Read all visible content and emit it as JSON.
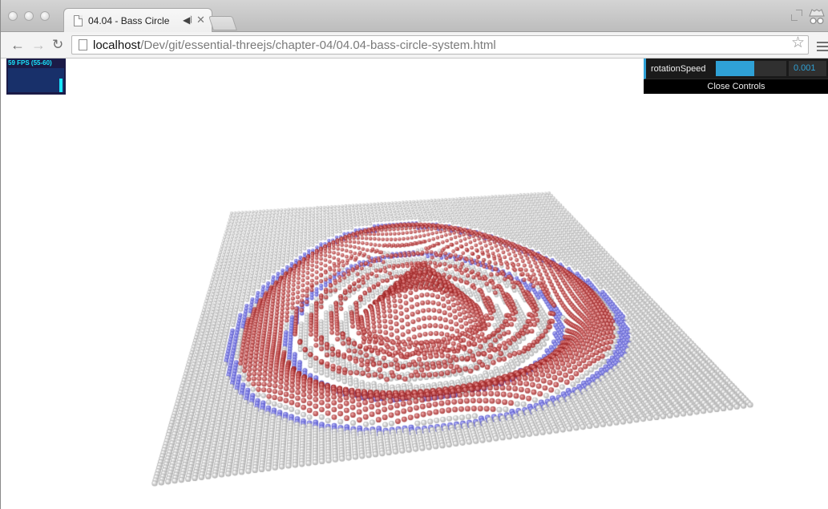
{
  "browser": {
    "tab": {
      "title": "04.04 - Bass Circle",
      "audio_icon": "speaker-icon",
      "close_icon": "close-icon"
    },
    "address": {
      "host": "localhost",
      "path": "/Dev/git/essential-threejs/chapter-04/04.04-bass-circle-system.html"
    },
    "icons": [
      "back-icon",
      "forward-icon",
      "reload-icon",
      "page-icon",
      "bookmark-star-icon",
      "menu-icon",
      "incognito-icon",
      "fullscreen-icon"
    ]
  },
  "stats": {
    "text": "59 FPS (55-60)",
    "level_fraction": 0.58,
    "color": "#19e6ff"
  },
  "gui": {
    "controls": [
      {
        "label": "rotationSpeed",
        "value": "0.001",
        "fill_fraction": 0.55
      }
    ],
    "close_label": "Close Controls",
    "accent": "#2fa1d6"
  },
  "scene": {
    "description_colors": {
      "sphere_base": "#d9d9d9",
      "wave_red": "#c23b3b",
      "wave_blue": "#6f6fe0"
    }
  }
}
